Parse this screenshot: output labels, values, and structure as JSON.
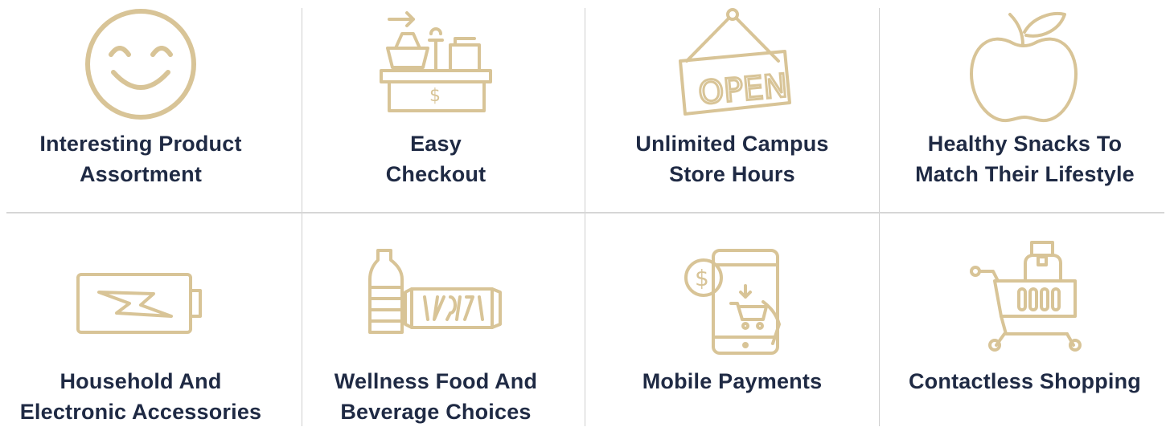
{
  "colors": {
    "accent": "#d8c497",
    "text": "#1f2a44",
    "divider": "#d0d0d0"
  },
  "features": [
    {
      "icon": "smiley-icon",
      "label": "Interesting Product\nAssortment"
    },
    {
      "icon": "checkout-counter-icon",
      "label": "Easy\nCheckout"
    },
    {
      "icon": "open-sign-icon",
      "label": "Unlimited Campus\nStore Hours",
      "sign_text": "OPEN"
    },
    {
      "icon": "apple-icon",
      "label": "Healthy Snacks To\nMatch Their Lifestyle"
    },
    {
      "icon": "battery-icon",
      "label": "Household And\nElectronic Accessories"
    },
    {
      "icon": "bottle-and-bar-icon",
      "label": "Wellness Food And\nBeverage Choices"
    },
    {
      "icon": "mobile-payment-icon",
      "label": "Mobile Payments"
    },
    {
      "icon": "shopping-cart-icon",
      "label": "Contactless Shopping"
    }
  ]
}
